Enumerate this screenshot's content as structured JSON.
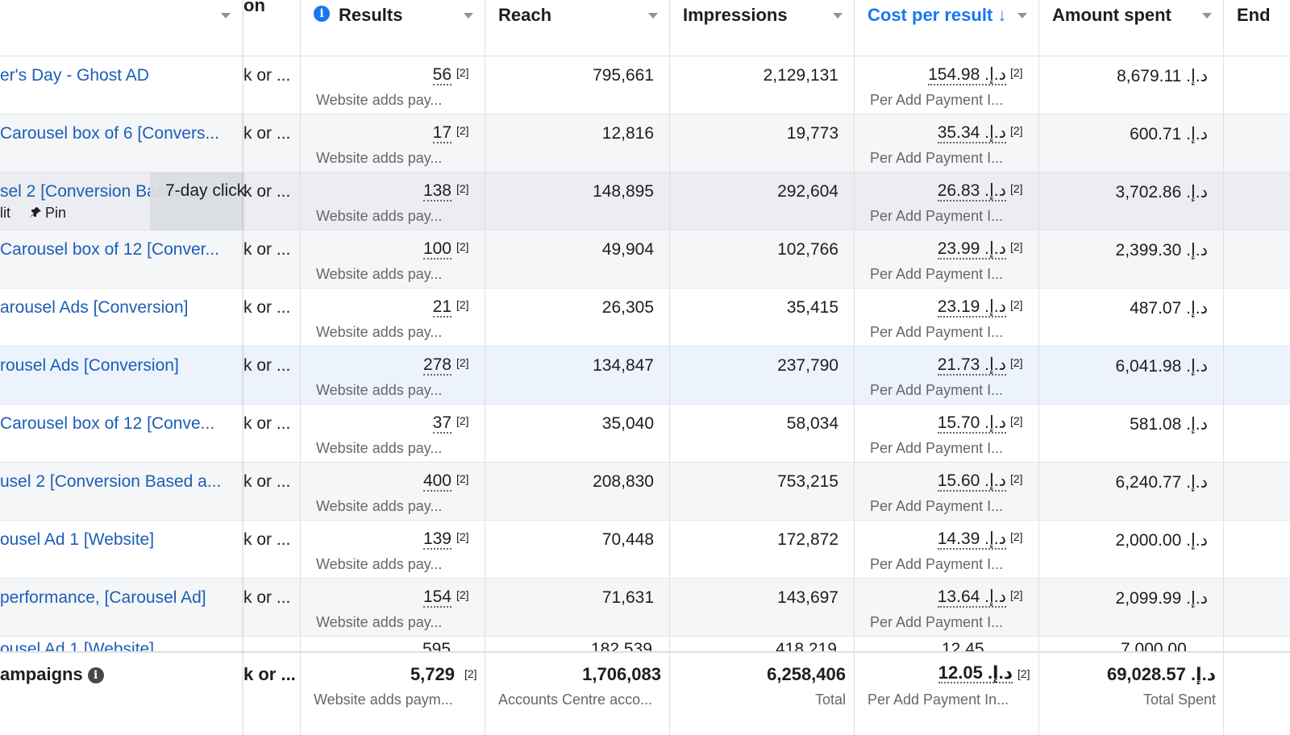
{
  "columns": {
    "name_partial": "",
    "attribution_partial": "on",
    "results": "Results",
    "reach": "Reach",
    "impressions": "Impressions",
    "cost_per_result": "Cost per result ↓",
    "amount_spent": "Amount spent",
    "ends_partial": "End"
  },
  "accent_color": "#1877f2",
  "link_color": "#1b5eb8",
  "rows": [
    {
      "name": "er's Day - Ghost AD",
      "attr": "k or ...",
      "results": "56",
      "results_sub": "Website adds pay...",
      "reach": "795,661",
      "impressions": "2,129,131",
      "cpr": "154.98 د.إ.‏",
      "cpr_sub": "Per Add Payment I...",
      "spent": "8,679.11 د.إ.‏"
    },
    {
      "name": "Carousel box of 6 [Convers...",
      "attr": "k or ...",
      "results": "17",
      "results_sub": "Website adds pay...",
      "reach": "12,816",
      "impressions": "19,773",
      "cpr": "35.34 د.إ.‏",
      "cpr_sub": "Per Add Payment I...",
      "spent": "600.71 د.إ.‏"
    },
    {
      "name": "sel 2 [Conversion Based a...",
      "attr": "k or ...",
      "results": "138",
      "results_sub": "Website adds pay...",
      "reach": "148,895",
      "impressions": "292,604",
      "cpr": "26.83 د.إ.‏",
      "cpr_sub": "Per Add Payment I...",
      "spent": "3,702.86 د.إ.‏"
    },
    {
      "name": "Carousel box of 12 [Conver...",
      "attr": "k or ...",
      "results": "100",
      "results_sub": "Website adds pay...",
      "reach": "49,904",
      "impressions": "102,766",
      "cpr": "23.99 د.إ.‏",
      "cpr_sub": "Per Add Payment I...",
      "spent": "2,399.30 د.إ.‏"
    },
    {
      "name": "arousel Ads [Conversion]",
      "attr": "k or ...",
      "results": "21",
      "results_sub": "Website adds pay...",
      "reach": "26,305",
      "impressions": "35,415",
      "cpr": "23.19 د.إ.‏",
      "cpr_sub": "Per Add Payment I...",
      "spent": "487.07 د.إ.‏"
    },
    {
      "name": "rousel Ads [Conversion]",
      "attr": "k or ...",
      "results": "278",
      "results_sub": "Website adds pay...",
      "reach": "134,847",
      "impressions": "237,790",
      "cpr": "21.73 د.إ.‏",
      "cpr_sub": "Per Add Payment I...",
      "spent": "6,041.98 د.إ.‏"
    },
    {
      "name": " Carousel box of 12 [Conve...",
      "attr": "k or ...",
      "results": "37",
      "results_sub": "Website adds pay...",
      "reach": "35,040",
      "impressions": "58,034",
      "cpr": "15.70 د.إ.‏",
      "cpr_sub": "Per Add Payment I...",
      "spent": "581.08 د.إ.‏"
    },
    {
      "name": "usel 2 [Conversion Based a...",
      "attr": "k or ...",
      "results": "400",
      "results_sub": "Website adds pay...",
      "reach": "208,830",
      "impressions": "753,215",
      "cpr": "15.60 د.إ.‏",
      "cpr_sub": "Per Add Payment I...",
      "spent": "6,240.77 د.إ.‏"
    },
    {
      "name": "ousel Ad 1 [Website]",
      "attr": "k or ...",
      "results": "139",
      "results_sub": "Website adds pay...",
      "reach": "70,448",
      "impressions": "172,872",
      "cpr": "14.39 د.إ.‏",
      "cpr_sub": "Per Add Payment I...",
      "spent": "2,000.00 د.إ.‏"
    },
    {
      "name": " performance, [Carousel Ad]",
      "attr": "k or ...",
      "results": "154",
      "results_sub": "Website adds pay...",
      "reach": "71,631",
      "impressions": "143,697",
      "cpr": "13.64 د.إ.‏",
      "cpr_sub": "Per Add Payment I...",
      "spent": "2,099.99 د.إ.‏"
    }
  ],
  "superscript": "[2]",
  "hover_tooltip": "7-day click",
  "row_actions": {
    "edit_partial": "lit",
    "pin": "Pin"
  },
  "footer": {
    "label": "ampaigns",
    "attr": "k or ...",
    "results": "5,729",
    "results_sub": "Website adds paym...",
    "reach": "1,706,083",
    "reach_sub": "Accounts Centre acco...",
    "impressions": "6,258,406",
    "impressions_sub": "Total",
    "cpr": "12.05 د.إ.‏",
    "cpr_sub": "Per Add Payment In...",
    "spent": "69,028.57 د.إ.‏",
    "spent_sub": "Total Spent"
  }
}
